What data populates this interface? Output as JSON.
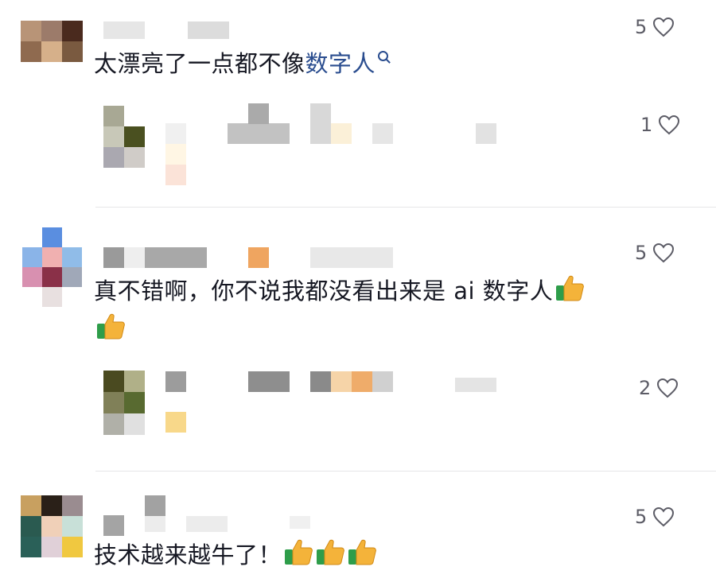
{
  "comments": [
    {
      "avatar": [
        "#b89477",
        "#9c7b6a",
        "#4a2a1e",
        "#8f6a4f",
        "#d6b08a",
        "#7a5a40"
      ],
      "text_plain": "太漂亮了一点都不像",
      "text_link": "数字人",
      "likes": "5",
      "reply": {
        "avatar": [
          "#a8a894",
          "#ffffff",
          "#c8c8b8",
          "#4a5020",
          "#aaa8b0",
          "#d0ccc8"
        ],
        "likes": "1"
      }
    },
    {
      "avatar": [
        "#ffffff",
        "#5a8ee0",
        "#ffffff",
        "#8ab4e8",
        "#f0b0b0",
        "#90bce8",
        "#d890b0",
        "#8a3048",
        "#a0a8b8",
        "#ffffff",
        "#e8e0e0",
        "#ffffff"
      ],
      "text_line1": "真不错啊，你不说我都没看出来是 ai 数字人",
      "likes": "5",
      "reply": {
        "avatar": [
          "#4a4a20",
          "#b0b088",
          "#808058",
          "#586a30",
          "#b0b0a8",
          "#e0e0e0"
        ],
        "likes": "2"
      }
    },
    {
      "avatar": [
        "#c8a060",
        "#2a2018",
        "#9a8c90",
        "#2a5a50",
        "#f0d0b8",
        "#c8e0d8",
        "#2a6058",
        "#e0d0d8",
        "#f0c840"
      ],
      "text": "技术越来越牛了！",
      "likes": "5"
    }
  ],
  "icons": {
    "like": "heart-outline-icon",
    "search": "search-icon",
    "thumbs_up": "thumbs-up-emoji"
  },
  "colors": {
    "text": "#161823",
    "link": "#2a4d8f",
    "muted": "#5c5c66"
  }
}
